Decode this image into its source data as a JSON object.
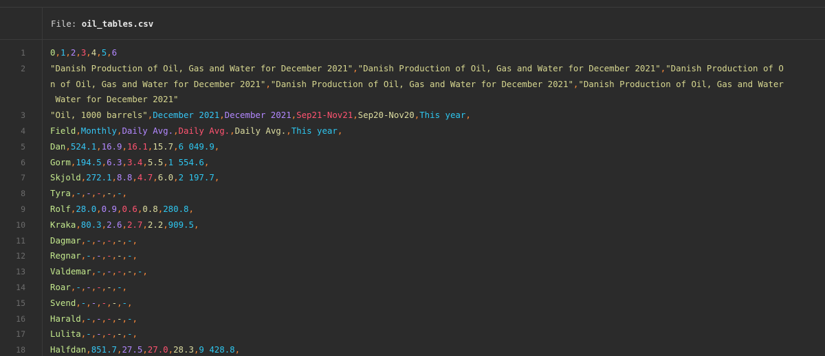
{
  "file": {
    "label": "File: ",
    "name": "oil_tables.csv"
  },
  "lines": [
    {
      "num": "1",
      "rows": [
        [
          [
            "0",
            "c0"
          ],
          [
            ",",
            "cm"
          ],
          [
            "1",
            "c1"
          ],
          [
            ",",
            "cm"
          ],
          [
            "2",
            "c2"
          ],
          [
            ",",
            "cm"
          ],
          [
            "3",
            "c3"
          ],
          [
            ",",
            "cm"
          ],
          [
            "4",
            "c4"
          ],
          [
            ",",
            "cm"
          ],
          [
            "5",
            "c5"
          ],
          [
            ",",
            "cm"
          ],
          [
            "6",
            "c2"
          ]
        ]
      ]
    },
    {
      "num": "2",
      "rows": [
        [
          [
            "\"Danish Production of Oil, Gas and Water for December 2021\"",
            "q"
          ],
          [
            ",",
            "cm"
          ],
          [
            "\"Danish Production of Oil, Gas and Water for December 2021\"",
            "q"
          ],
          [
            ",",
            "cm"
          ],
          [
            "\"Danish Production of O",
            "q"
          ]
        ],
        [
          [
            "n of Oil, Gas and Water for December 2021\"",
            "q"
          ],
          [
            ",",
            "cm"
          ],
          [
            "\"Danish Production of Oil, Gas and Water for December 2021\"",
            "q"
          ],
          [
            ",",
            "cm"
          ],
          [
            "\"Danish Production of Oil, Gas and Water",
            "q"
          ]
        ],
        [
          [
            " Water for December 2021\"",
            "q"
          ]
        ]
      ]
    },
    {
      "num": "3",
      "rows": [
        [
          [
            "\"Oil, 1000 barrels\"",
            "q"
          ],
          [
            ",",
            "cm"
          ],
          [
            "December 2021",
            "c1"
          ],
          [
            ",",
            "cm"
          ],
          [
            "December 2021",
            "c2"
          ],
          [
            ",",
            "cm"
          ],
          [
            "Sep21-Nov21",
            "c3"
          ],
          [
            ",",
            "cm"
          ],
          [
            "Sep20-Nov20",
            "c4"
          ],
          [
            ",",
            "cm"
          ],
          [
            "This year",
            "c5"
          ],
          [
            ",",
            "cm"
          ]
        ]
      ]
    },
    {
      "num": "4",
      "rows": [
        [
          [
            "Field",
            "c0"
          ],
          [
            ",",
            "cm"
          ],
          [
            "Monthly",
            "c1"
          ],
          [
            ",",
            "cm"
          ],
          [
            "Daily Avg.",
            "c2"
          ],
          [
            ",",
            "cm"
          ],
          [
            "Daily Avg.",
            "c3"
          ],
          [
            ",",
            "cm"
          ],
          [
            "Daily Avg.",
            "c4"
          ],
          [
            ",",
            "cm"
          ],
          [
            "This year",
            "c5"
          ],
          [
            ",",
            "cm"
          ]
        ]
      ]
    },
    {
      "num": "5",
      "rows": [
        [
          [
            "Dan",
            "c0"
          ],
          [
            ",",
            "cm"
          ],
          [
            "524.1",
            "c1"
          ],
          [
            ",",
            "cm"
          ],
          [
            "16.9",
            "c2"
          ],
          [
            ",",
            "cm"
          ],
          [
            "16.1",
            "c3"
          ],
          [
            ",",
            "cm"
          ],
          [
            "15.7",
            "c4"
          ],
          [
            ",",
            "cm"
          ],
          [
            "6 049.9",
            "c5"
          ],
          [
            ",",
            "cm"
          ]
        ]
      ]
    },
    {
      "num": "6",
      "rows": [
        [
          [
            "Gorm",
            "c0"
          ],
          [
            ",",
            "cm"
          ],
          [
            "194.5",
            "c1"
          ],
          [
            ",",
            "cm"
          ],
          [
            "6.3",
            "c2"
          ],
          [
            ",",
            "cm"
          ],
          [
            "3.4",
            "c3"
          ],
          [
            ",",
            "cm"
          ],
          [
            "5.5",
            "c4"
          ],
          [
            ",",
            "cm"
          ],
          [
            "1 554.6",
            "c5"
          ],
          [
            ",",
            "cm"
          ]
        ]
      ]
    },
    {
      "num": "7",
      "rows": [
        [
          [
            "Skjold",
            "c0"
          ],
          [
            ",",
            "cm"
          ],
          [
            "272.1",
            "c1"
          ],
          [
            ",",
            "cm"
          ],
          [
            "8.8",
            "c2"
          ],
          [
            ",",
            "cm"
          ],
          [
            "4.7",
            "c3"
          ],
          [
            ",",
            "cm"
          ],
          [
            "6.0",
            "c4"
          ],
          [
            ",",
            "cm"
          ],
          [
            "2 197.7",
            "c5"
          ],
          [
            ",",
            "cm"
          ]
        ]
      ]
    },
    {
      "num": "8",
      "rows": [
        [
          [
            "Tyra",
            "c0"
          ],
          [
            ",",
            "cm"
          ],
          [
            "-",
            "c1"
          ],
          [
            ",",
            "cm"
          ],
          [
            "-",
            "c2"
          ],
          [
            ",",
            "cm"
          ],
          [
            "-",
            "c3"
          ],
          [
            ",",
            "cm"
          ],
          [
            "-",
            "c4"
          ],
          [
            ",",
            "cm"
          ],
          [
            "-",
            "c5"
          ],
          [
            ",",
            "cm"
          ]
        ]
      ]
    },
    {
      "num": "9",
      "rows": [
        [
          [
            "Rolf",
            "c0"
          ],
          [
            ",",
            "cm"
          ],
          [
            "28.0",
            "c1"
          ],
          [
            ",",
            "cm"
          ],
          [
            "0.9",
            "c2"
          ],
          [
            ",",
            "cm"
          ],
          [
            "0.6",
            "c3"
          ],
          [
            ",",
            "cm"
          ],
          [
            "0.8",
            "c4"
          ],
          [
            ",",
            "cm"
          ],
          [
            "280.8",
            "c5"
          ],
          [
            ",",
            "cm"
          ]
        ]
      ]
    },
    {
      "num": "10",
      "rows": [
        [
          [
            "Kraka",
            "c0"
          ],
          [
            ",",
            "cm"
          ],
          [
            "80.3",
            "c1"
          ],
          [
            ",",
            "cm"
          ],
          [
            "2.6",
            "c2"
          ],
          [
            ",",
            "cm"
          ],
          [
            "2.7",
            "c3"
          ],
          [
            ",",
            "cm"
          ],
          [
            "2.2",
            "c4"
          ],
          [
            ",",
            "cm"
          ],
          [
            "909.5",
            "c5"
          ],
          [
            ",",
            "cm"
          ]
        ]
      ]
    },
    {
      "num": "11",
      "rows": [
        [
          [
            "Dagmar",
            "c0"
          ],
          [
            ",",
            "cm"
          ],
          [
            "-",
            "c1"
          ],
          [
            ",",
            "cm"
          ],
          [
            "-",
            "c2"
          ],
          [
            ",",
            "cm"
          ],
          [
            "-",
            "c3"
          ],
          [
            ",",
            "cm"
          ],
          [
            "-",
            "c4"
          ],
          [
            ",",
            "cm"
          ],
          [
            "-",
            "c5"
          ],
          [
            ",",
            "cm"
          ]
        ]
      ]
    },
    {
      "num": "12",
      "rows": [
        [
          [
            "Regnar",
            "c0"
          ],
          [
            ",",
            "cm"
          ],
          [
            "-",
            "c1"
          ],
          [
            ",",
            "cm"
          ],
          [
            "-",
            "c2"
          ],
          [
            ",",
            "cm"
          ],
          [
            "-",
            "c3"
          ],
          [
            ",",
            "cm"
          ],
          [
            "-",
            "c4"
          ],
          [
            ",",
            "cm"
          ],
          [
            "-",
            "c5"
          ],
          [
            ",",
            "cm"
          ]
        ]
      ]
    },
    {
      "num": "13",
      "rows": [
        [
          [
            "Valdemar",
            "c0"
          ],
          [
            ",",
            "cm"
          ],
          [
            "-",
            "c1"
          ],
          [
            ",",
            "cm"
          ],
          [
            "-",
            "c2"
          ],
          [
            ",",
            "cm"
          ],
          [
            "-",
            "c3"
          ],
          [
            ",",
            "cm"
          ],
          [
            "-",
            "c4"
          ],
          [
            ",",
            "cm"
          ],
          [
            "-",
            "c5"
          ],
          [
            ",",
            "cm"
          ]
        ]
      ]
    },
    {
      "num": "14",
      "rows": [
        [
          [
            "Roar",
            "c0"
          ],
          [
            ",",
            "cm"
          ],
          [
            "-",
            "c1"
          ],
          [
            ",",
            "cm"
          ],
          [
            "-",
            "c2"
          ],
          [
            ",",
            "cm"
          ],
          [
            "-",
            "c3"
          ],
          [
            ",",
            "cm"
          ],
          [
            "-",
            "c4"
          ],
          [
            ",",
            "cm"
          ],
          [
            "-",
            "c5"
          ],
          [
            ",",
            "cm"
          ]
        ]
      ]
    },
    {
      "num": "15",
      "rows": [
        [
          [
            "Svend",
            "c0"
          ],
          [
            ",",
            "cm"
          ],
          [
            "-",
            "c1"
          ],
          [
            ",",
            "cm"
          ],
          [
            "-",
            "c2"
          ],
          [
            ",",
            "cm"
          ],
          [
            "-",
            "c3"
          ],
          [
            ",",
            "cm"
          ],
          [
            "-",
            "c4"
          ],
          [
            ",",
            "cm"
          ],
          [
            "-",
            "c5"
          ],
          [
            ",",
            "cm"
          ]
        ]
      ]
    },
    {
      "num": "16",
      "rows": [
        [
          [
            "Harald",
            "c0"
          ],
          [
            ",",
            "cm"
          ],
          [
            "-",
            "c1"
          ],
          [
            ",",
            "cm"
          ],
          [
            "-",
            "c2"
          ],
          [
            ",",
            "cm"
          ],
          [
            "-",
            "c3"
          ],
          [
            ",",
            "cm"
          ],
          [
            "-",
            "c4"
          ],
          [
            ",",
            "cm"
          ],
          [
            "-",
            "c5"
          ],
          [
            ",",
            "cm"
          ]
        ]
      ]
    },
    {
      "num": "17",
      "rows": [
        [
          [
            "Lulita",
            "c0"
          ],
          [
            ",",
            "cm"
          ],
          [
            "-",
            "c1"
          ],
          [
            ",",
            "cm"
          ],
          [
            "-",
            "c2"
          ],
          [
            ",",
            "cm"
          ],
          [
            "-",
            "c3"
          ],
          [
            ",",
            "cm"
          ],
          [
            "-",
            "c4"
          ],
          [
            ",",
            "cm"
          ],
          [
            "-",
            "c5"
          ],
          [
            ",",
            "cm"
          ]
        ]
      ]
    },
    {
      "num": "18",
      "rows": [
        [
          [
            "Halfdan",
            "c0"
          ],
          [
            ",",
            "cm"
          ],
          [
            "851.7",
            "c1"
          ],
          [
            ",",
            "cm"
          ],
          [
            "27.5",
            "c2"
          ],
          [
            ",",
            "cm"
          ],
          [
            "27.0",
            "c3"
          ],
          [
            ",",
            "cm"
          ],
          [
            "28.3",
            "c4"
          ],
          [
            ",",
            "cm"
          ],
          [
            "9 428.8",
            "c5"
          ],
          [
            ",",
            "cm"
          ]
        ]
      ]
    }
  ]
}
